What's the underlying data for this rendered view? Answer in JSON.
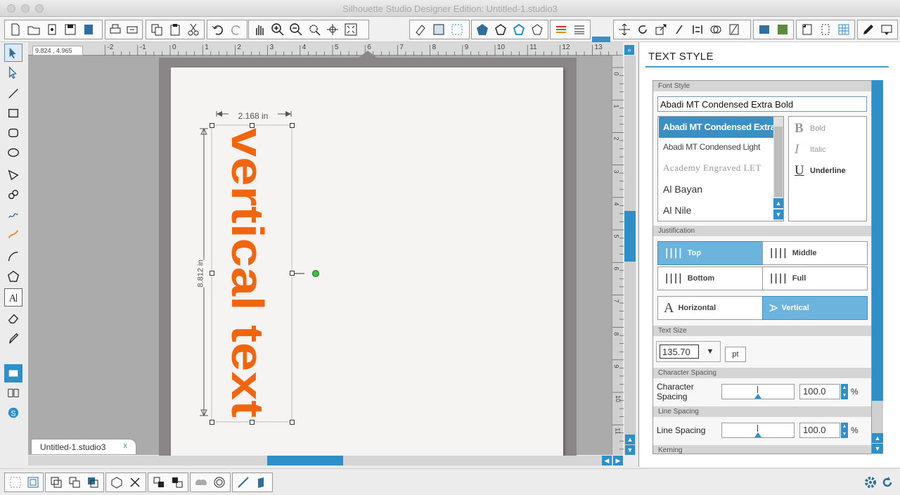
{
  "window": {
    "title": "Silhouette Studio Designer Edition: Untitled-1.studio3"
  },
  "ruler": {
    "coords": "9.824 , 4.965",
    "h_ticks": [
      "-2",
      "-1",
      "0",
      "1",
      "2",
      "3",
      "4",
      "5",
      "6",
      "7",
      "8",
      "9",
      "10",
      "11",
      "12",
      "13"
    ],
    "v_ticks": [
      "0",
      "1",
      "2",
      "3",
      "4",
      "5",
      "6",
      "7",
      "8",
      "9",
      "10",
      "11"
    ]
  },
  "design": {
    "text": "vertical text",
    "text_color": "#f2650f",
    "width_label": "2.168 in",
    "height_label": "8.812 in"
  },
  "doc_tab": {
    "label": "Untitled-1.studio3",
    "close": "x"
  },
  "panel": {
    "title": "TEXT STYLE",
    "font_style_header": "Font Style",
    "font_value": "Abadi MT Condensed Extra Bold",
    "fonts": [
      "Abadi MT Condensed Extra Bold",
      "Abadi MT Condensed Light",
      "Academy Engraved LET",
      "Al Bayan",
      "Al Nile"
    ],
    "styles": {
      "bold": "Bold",
      "italic": "Italic",
      "underline": "Underline"
    },
    "justification_header": "Justification",
    "justify": {
      "top": "Top",
      "middle": "Middle",
      "bottom": "Bottom",
      "full": "Full"
    },
    "orientation": {
      "horizontal": "Horizontal",
      "vertical": "Vertical"
    },
    "text_size_header": "Text Size",
    "text_size": "135.70",
    "unit": "pt",
    "char_spacing_header": "Character Spacing",
    "char_spacing_label": "Character Spacing",
    "char_spacing": "100.0",
    "line_spacing_header": "Line Spacing",
    "line_spacing_label": "Line Spacing",
    "line_spacing": "100.0",
    "percent": "%",
    "kerning_header": "Kerning"
  },
  "colors": {
    "accent": "#2e8fc9",
    "active_fill": "#6cb3dd",
    "handle_green": "#3ec13e"
  }
}
